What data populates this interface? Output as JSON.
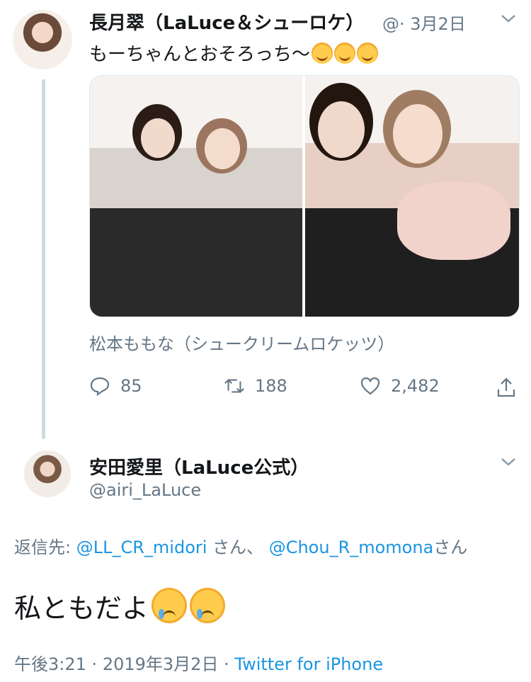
{
  "tweet1": {
    "name": "長月翠（LaLuce＆シューロケ）",
    "handle_trunc": "@·",
    "date": "3月2日",
    "text": "もーちゃんとおそろっち〜",
    "emoji_count": 3,
    "emoji_icon": "smiling-face-with-hearts-icon",
    "caption": "松本ももな（シュークリームロケッツ）",
    "actions": {
      "reply_count": "85",
      "retweet_count": "188",
      "like_count": "2,482"
    }
  },
  "tweet2": {
    "name": "安田愛里（LaLuce公式）",
    "handle": "@airi_LaLuce",
    "reply_prefix": "返信先:",
    "mention1": "@LL_CR_midori",
    "san1": "さん、",
    "mention2": "@Chou_R_momona",
    "san2": "さん",
    "text": "私ともだよ",
    "emoji_icon": "crying-face-icon",
    "time": "午後3:21",
    "sep": "·",
    "date": "2019年3月2日",
    "source": "Twitter for iPhone"
  },
  "colors": {
    "link": "#1b95e0",
    "muted": "#657786",
    "text": "#14171a"
  }
}
